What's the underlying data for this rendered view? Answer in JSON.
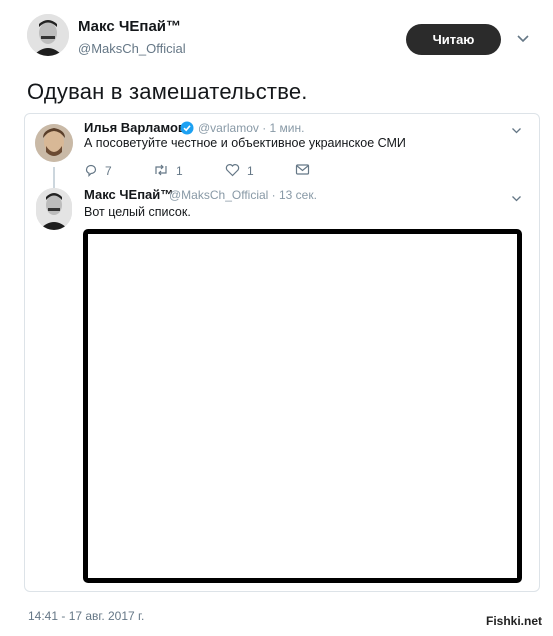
{
  "author": {
    "name": "Макс ЧЕпай™",
    "handle": "@MaksCh_Official"
  },
  "follow_label": "Читаю",
  "tweet_text": "Одуван в замешательстве.",
  "quoted": {
    "original": {
      "name": "Илья Варламов",
      "handle_time": "@varlamov · 1 мин.",
      "text": "А посоветуйте честное и объективное украинское СМИ",
      "reply_count": "7",
      "retweet_count": "1",
      "like_count": "1"
    },
    "reply": {
      "name": "Макс ЧЕпай™",
      "handle_time": "@MaksCh_Official · 13 сек.",
      "text": "Вот целый список."
    }
  },
  "timestamp": "14:41 - 17 авг. 2017 г.",
  "watermark": "Fishki.net",
  "colors": {
    "follow_bg": "#2b2b2b",
    "verified": "#1da1f2",
    "muted": "#657786"
  }
}
